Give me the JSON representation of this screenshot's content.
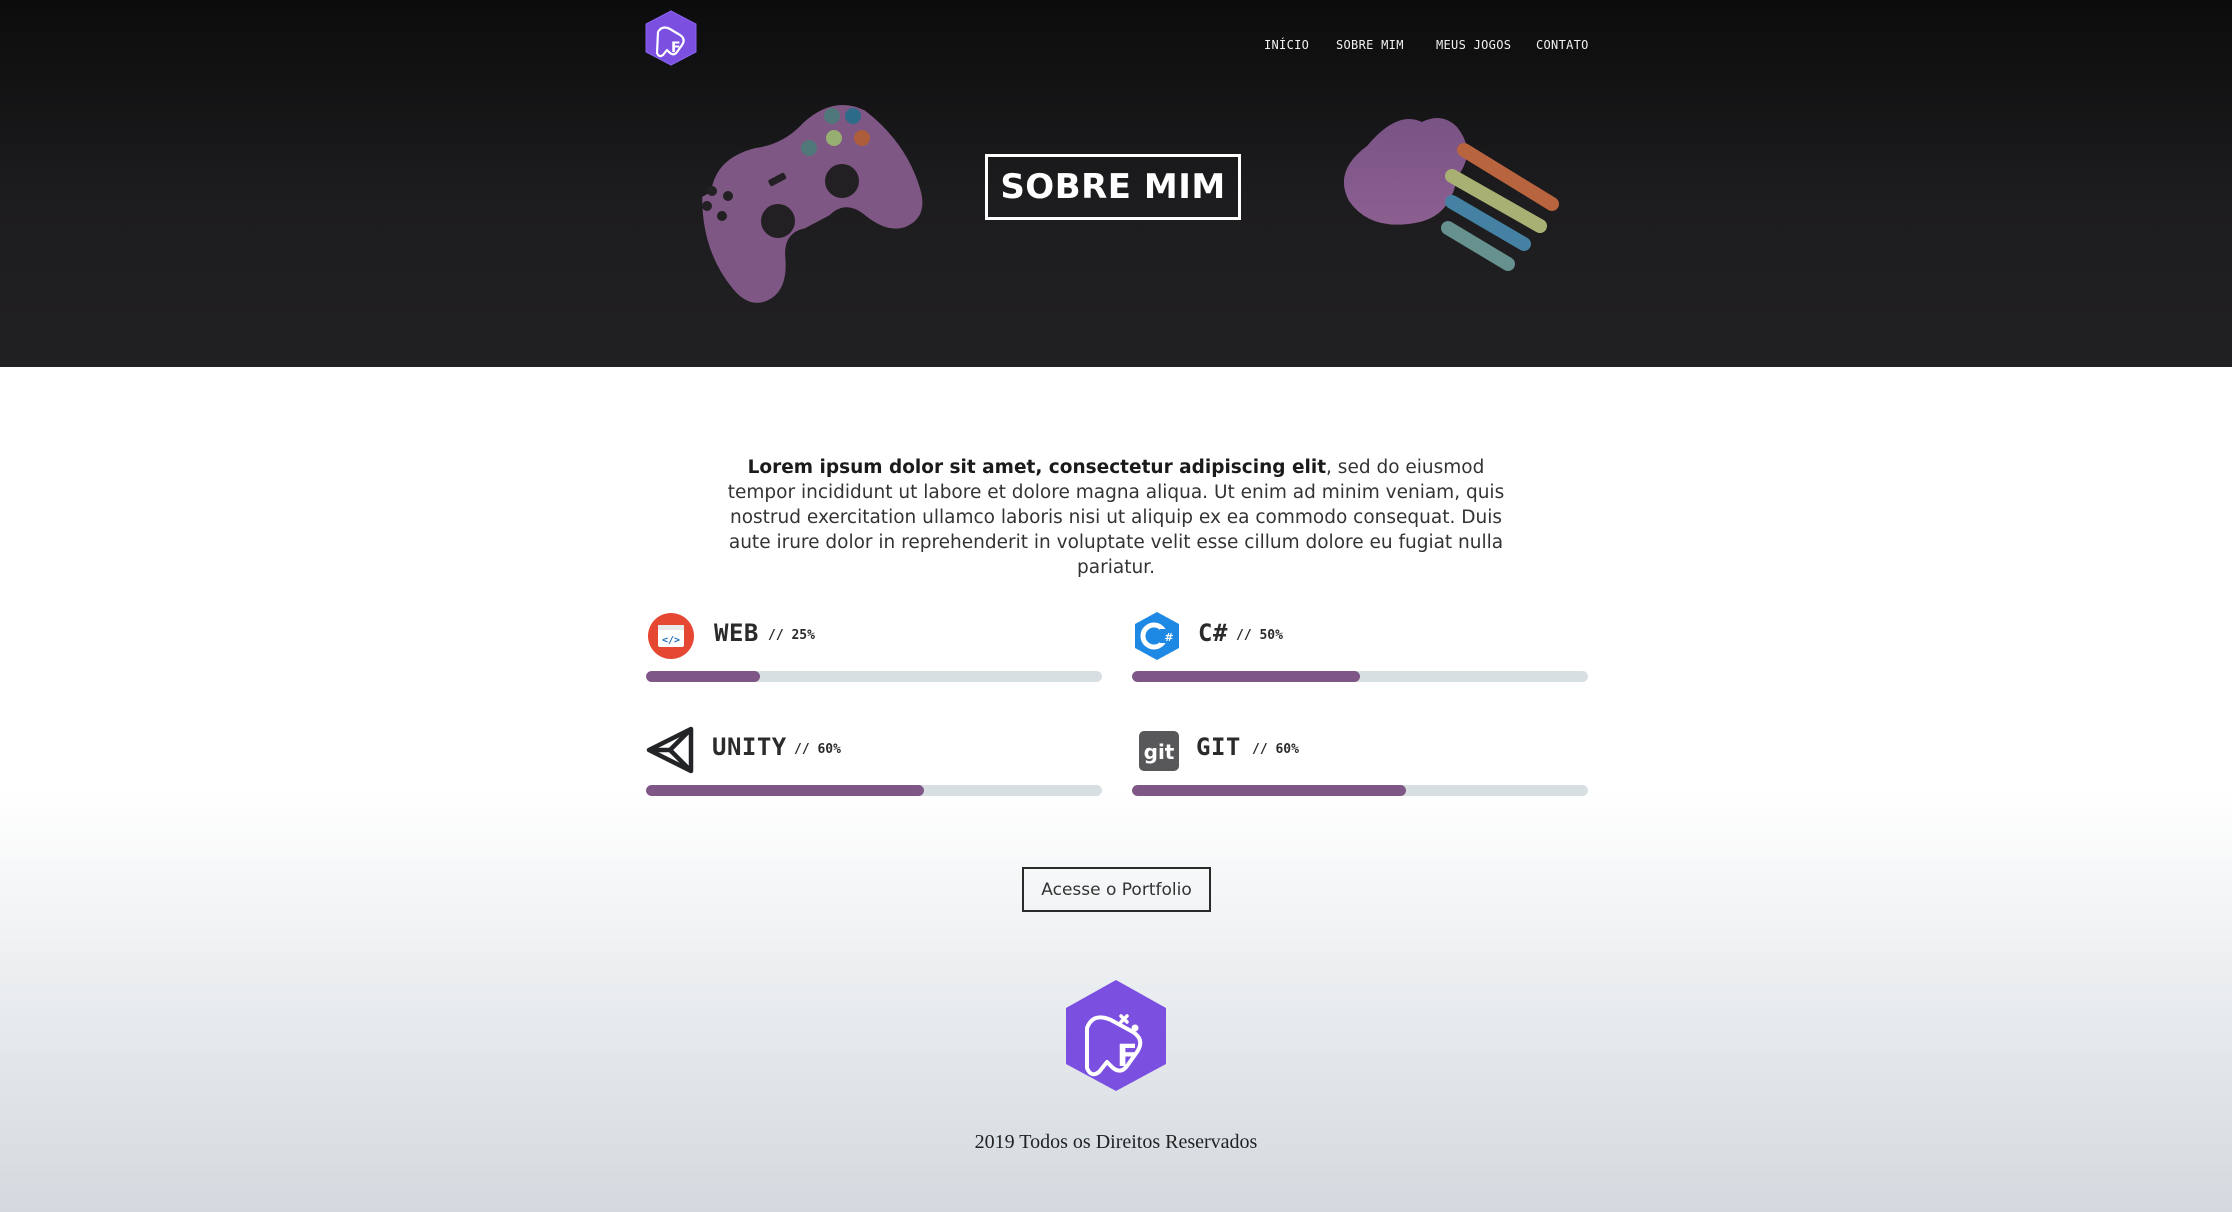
{
  "nav": {
    "items": [
      {
        "label": "INÍCIO"
      },
      {
        "label": "SOBRE MIM"
      },
      {
        "label": "MEUS JOGOS"
      },
      {
        "label": "CONTATO"
      }
    ]
  },
  "hero": {
    "title": "SOBRE MIM"
  },
  "intro": {
    "bold": "Lorem ipsum dolor sit amet, consectetur adipiscing elit",
    "text": ", sed do eiusmod tempor incididunt ut labore et dolore magna aliqua. Ut enim ad minim veniam, quis nostrud exercitation ullamco laboris nisi ut aliquip ex ea commodo consequat. Duis aute irure dolor in reprehenderit in voluptate velit esse cillum dolore eu fugiat nulla pariatur."
  },
  "skills": [
    {
      "name": "WEB",
      "percent": "// 25%",
      "level": 0.25,
      "icon": "html-code-icon"
    },
    {
      "name": "C#",
      "percent": "// 50%",
      "level": 0.5,
      "icon": "csharp-icon"
    },
    {
      "name": "UNITY",
      "percent": "// 60%",
      "level": 0.61,
      "icon": "unity-icon"
    },
    {
      "name": "GIT",
      "percent": "// 60%",
      "level": 0.6,
      "icon": "git-icon"
    }
  ],
  "portfolio_button": "Acesse o Portfolio",
  "footer": {
    "text": "2019 Todos os Direitos Reservados"
  },
  "colors": {
    "accent": "#7f5786",
    "brand": "#7b4fe0"
  }
}
